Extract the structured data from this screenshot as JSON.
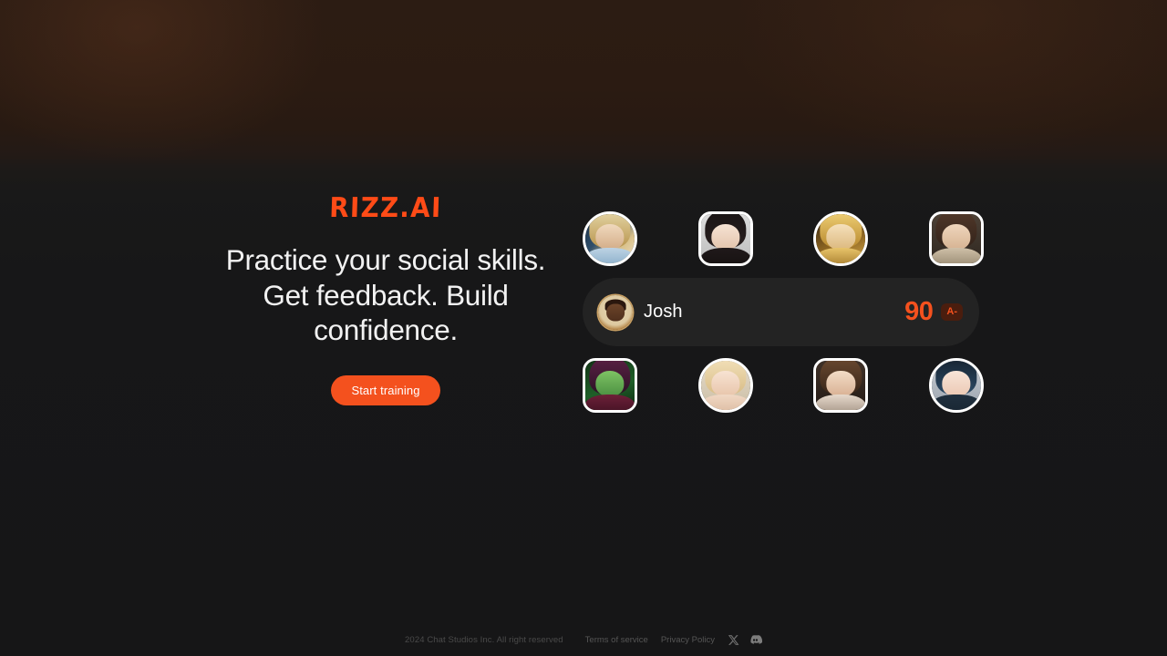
{
  "brand": {
    "logo_text": "RIZZ.AI",
    "accent_color": "#F4511E"
  },
  "hero": {
    "headline_line1": "Practice your social skills.",
    "headline_line2": "Get feedback. Build",
    "headline_line3": "confidence.",
    "cta_label": "Start training"
  },
  "avatars": {
    "top_row": [
      {
        "name": "avatar-sci-fi-woman",
        "shape": "circle"
      },
      {
        "name": "avatar-asian-woman",
        "shape": "square"
      },
      {
        "name": "avatar-golden-elf",
        "shape": "circle"
      },
      {
        "name": "avatar-period-dress-woman",
        "shape": "square"
      }
    ],
    "bottom_row": [
      {
        "name": "avatar-green-skinned-woman",
        "shape": "square"
      },
      {
        "name": "avatar-blonde-woman",
        "shape": "circle"
      },
      {
        "name": "avatar-brunette-woman",
        "shape": "square"
      },
      {
        "name": "avatar-blue-hair-anime-woman",
        "shape": "circle"
      }
    ]
  },
  "score_card": {
    "avatar_icon": "person-avatar-icon",
    "name": "Josh",
    "score": "90",
    "grade": "A-"
  },
  "footer": {
    "copyright": "2024 Chat Studios Inc. All right reserved",
    "links": [
      {
        "label": "Terms of service"
      },
      {
        "label": "Privacy Policy"
      }
    ],
    "social": [
      {
        "icon": "x-twitter-icon"
      },
      {
        "icon": "discord-icon"
      }
    ]
  }
}
